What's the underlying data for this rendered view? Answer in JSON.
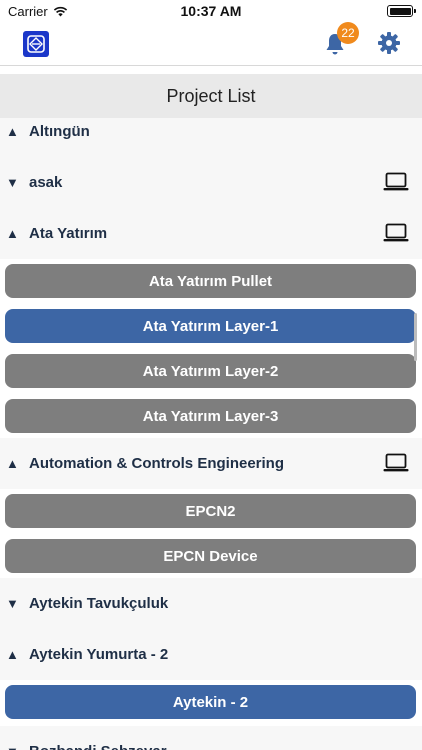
{
  "status": {
    "carrier": "Carrier",
    "time": "10:37 AM"
  },
  "header": {
    "notification_count": "22"
  },
  "page_title": "Project List",
  "groups": [
    {
      "name": "Altıngün",
      "expanded": true,
      "has_device_icon": false
    },
    {
      "name": "asak",
      "expanded": false,
      "has_device_icon": true
    },
    {
      "name": "Ata Yatırım",
      "expanded": true,
      "has_device_icon": true,
      "items": [
        {
          "label": "Ata Yatırım Pullet",
          "selected": false
        },
        {
          "label": "Ata Yatırım Layer-1",
          "selected": true
        },
        {
          "label": "Ata Yatırım Layer-2",
          "selected": false
        },
        {
          "label": "Ata Yatırım Layer-3",
          "selected": false
        }
      ]
    },
    {
      "name": "Automation & Controls Engineering",
      "expanded": true,
      "has_device_icon": true,
      "items": [
        {
          "label": "EPCN2",
          "selected": false
        },
        {
          "label": "EPCN Device",
          "selected": false
        }
      ]
    },
    {
      "name": "Aytekin Tavukçuluk",
      "expanded": false,
      "has_device_icon": false
    },
    {
      "name": "Aytekin Yumurta - 2",
      "expanded": true,
      "has_device_icon": false,
      "items": [
        {
          "label": "Aytekin - 2",
          "selected": true
        }
      ]
    },
    {
      "name": "Bozbandi Sebzevar",
      "expanded": false,
      "has_device_icon": false
    }
  ],
  "colors": {
    "item_default": "#7e7e7e",
    "item_selected": "#3d66a5",
    "badge": "#f08a1d",
    "accent_icons": "#3d66a5"
  }
}
